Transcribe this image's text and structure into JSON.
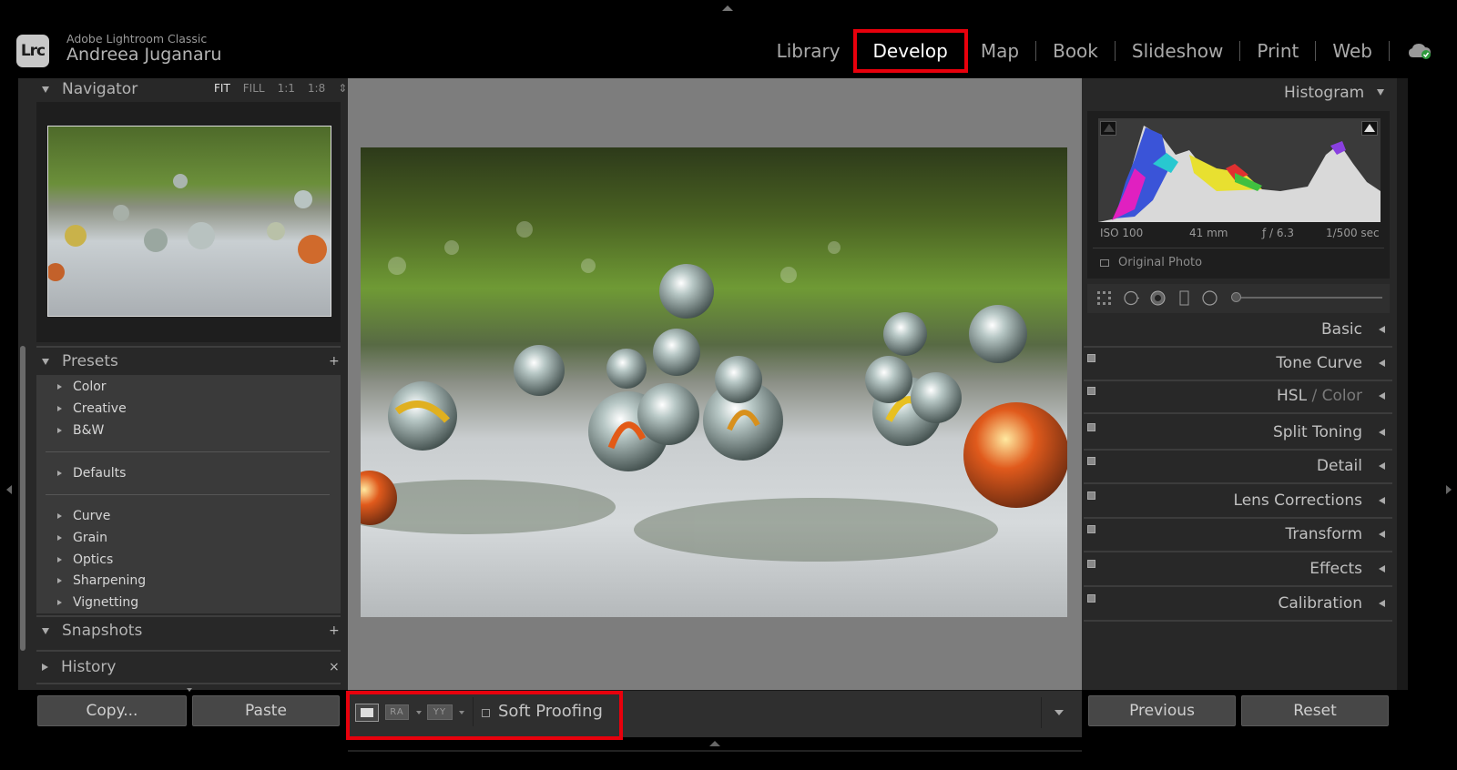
{
  "app": {
    "logo": "Lrc",
    "product": "Adobe Lightroom Classic",
    "user": "Andreea Juganaru"
  },
  "modules": [
    "Library",
    "Develop",
    "Map",
    "Book",
    "Slideshow",
    "Print",
    "Web"
  ],
  "active_module": "Develop",
  "left_panel": {
    "navigator": {
      "title": "Navigator",
      "zoom_options": [
        "FIT",
        "FILL",
        "1:1",
        "1:8"
      ],
      "active_zoom": "FIT"
    },
    "presets": {
      "title": "Presets",
      "add_label": "+",
      "groups": [
        [
          "Color",
          "Creative",
          "B&W"
        ],
        [
          "Defaults"
        ],
        [
          "Curve",
          "Grain",
          "Optics",
          "Sharpening",
          "Vignetting"
        ]
      ]
    },
    "snapshots": {
      "title": "Snapshots",
      "add_label": "+"
    },
    "history": {
      "title": "History",
      "clear_label": "×"
    },
    "buttons": {
      "copy": "Copy...",
      "paste": "Paste"
    }
  },
  "toolbar": {
    "before_after_1": "RA",
    "before_after_2": "YY",
    "soft_proofing": "Soft Proofing"
  },
  "right_panel": {
    "histogram": {
      "title": "Histogram",
      "iso": "ISO 100",
      "focal_length": "41 mm",
      "aperture": "ƒ / 6.3",
      "shutter": "1/500 sec",
      "original_photo": "Original Photo"
    },
    "sections": [
      "Basic",
      "Tone Curve",
      "HSL",
      "Color",
      "Split Toning",
      "Detail",
      "Lens Corrections",
      "Transform",
      "Effects",
      "Calibration"
    ],
    "buttons": {
      "previous": "Previous",
      "reset": "Reset"
    }
  },
  "colors": {
    "highlight": "#e8000c",
    "panel_bg": "#282828",
    "canvas_bg": "#7d7d7d"
  }
}
